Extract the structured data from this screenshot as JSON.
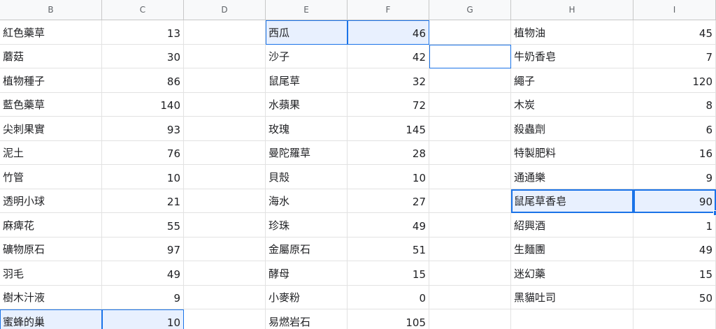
{
  "columns": [
    "B",
    "C",
    "D",
    "E",
    "F",
    "G",
    "H",
    "I"
  ],
  "rows": [
    [
      "紅色藥草",
      "13",
      "",
      "西瓜",
      "46",
      "",
      "植物油",
      "45"
    ],
    [
      "蘑菇",
      "30",
      "",
      "沙子",
      "42",
      "",
      "牛奶香皂",
      "7"
    ],
    [
      "植物種子",
      "86",
      "",
      "鼠尾草",
      "32",
      "",
      "繩子",
      "120"
    ],
    [
      "藍色藥草",
      "140",
      "",
      "水蘋果",
      "72",
      "",
      "木炭",
      "8"
    ],
    [
      "尖刺果實",
      "93",
      "",
      "玫瑰",
      "145",
      "",
      "殺蟲劑",
      "6"
    ],
    [
      "泥土",
      "76",
      "",
      "曼陀羅草",
      "28",
      "",
      "特製肥料",
      "16"
    ],
    [
      "竹管",
      "10",
      "",
      "貝殼",
      "10",
      "",
      "通通樂",
      "9"
    ],
    [
      "透明小球",
      "21",
      "",
      "海水",
      "27",
      "",
      "鼠尾草香皂",
      "90"
    ],
    [
      "麻痺花",
      "55",
      "",
      "珍珠",
      "49",
      "",
      "紹興酒",
      "1"
    ],
    [
      "礦物原石",
      "97",
      "",
      "金屬原石",
      "51",
      "",
      "生麵團",
      "49"
    ],
    [
      "羽毛",
      "49",
      "",
      "酵母",
      "15",
      "",
      "迷幻藥",
      "15"
    ],
    [
      "樹木汁液",
      "9",
      "",
      "小麥粉",
      "0",
      "",
      "黑貓吐司",
      "50"
    ],
    [
      "蜜蜂的巢",
      "10",
      "",
      "易燃岩石",
      "105",
      "",
      "",
      " "
    ]
  ]
}
